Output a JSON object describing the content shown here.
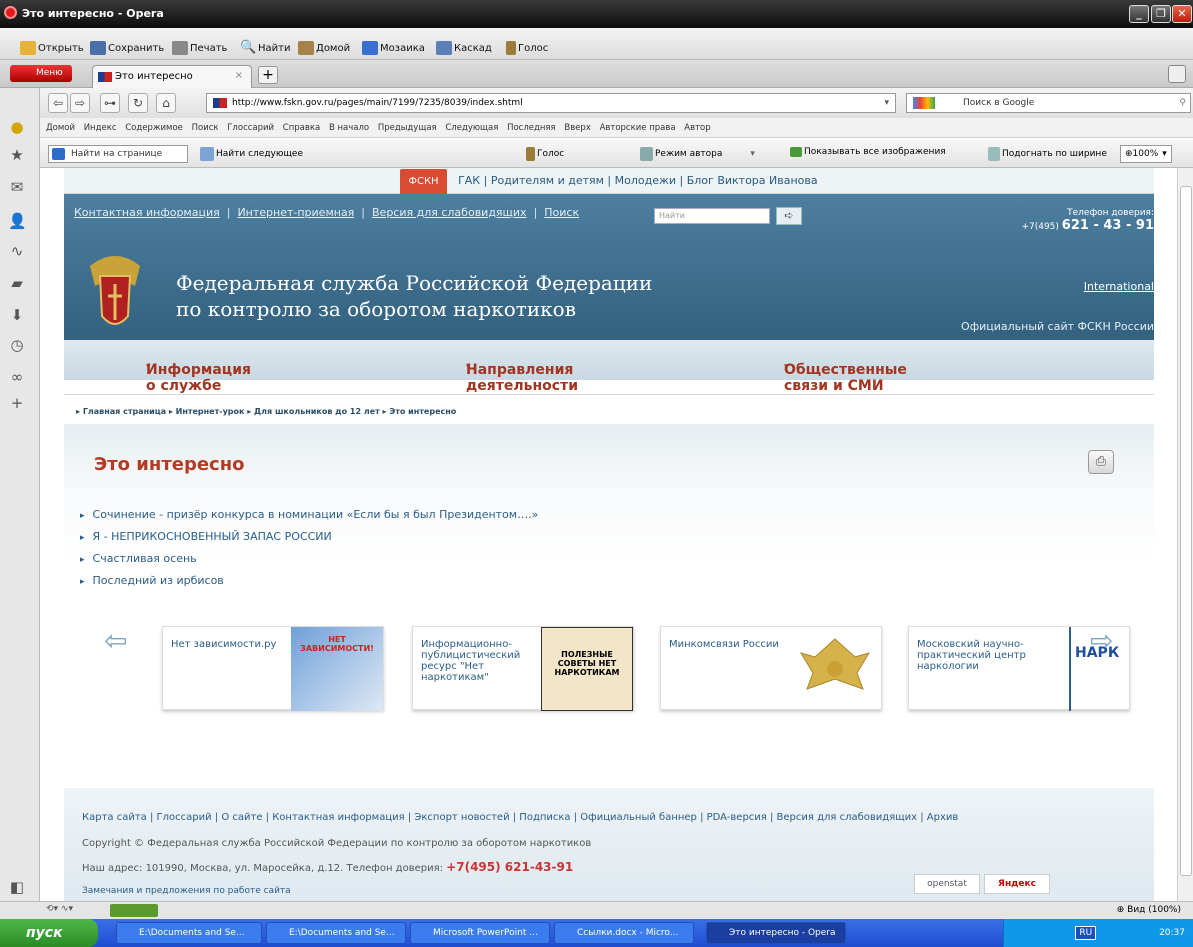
{
  "window": {
    "title": "Это интересно - Opera"
  },
  "toolbar": {
    "items": [
      "Открыть",
      "Сохранить",
      "Печать",
      "Найти",
      "Домой",
      "Мозаика",
      "Каскад",
      "Голос"
    ]
  },
  "tabs": {
    "menu": "Меню",
    "active": "Это интересно",
    "close": "×",
    "new": "+"
  },
  "address": {
    "url": "http://www.fskn.gov.ru/pages/main/7199/7235/8039/index.shtml",
    "search_placeholder": "Поиск в Google"
  },
  "bookmarks": [
    "Домой",
    "Индекс",
    "Содержимое",
    "Поиск",
    "Глоссарий",
    "Справка",
    "В начало",
    "Предыдущая",
    "Следующая",
    "Последняя",
    "Вверх",
    "Авторские права",
    "Автор"
  ],
  "findbar": {
    "placeholder": "Найти на странице",
    "next": "Найти следующее",
    "voice": "Голос",
    "author": "Режим автора",
    "images": "Показывать все изображения",
    "fit": "Подогнать по ширине",
    "zoom": "100%"
  },
  "page": {
    "topnav": {
      "active": "ФСКН",
      "items": [
        "ГАК",
        "Родителям и детям",
        "Молодежи",
        "Блог Виктора Иванова"
      ]
    },
    "header": {
      "links": [
        "Контактная информация",
        "Интернет-приемная",
        "Версия для слабовидящих",
        "Поиск"
      ],
      "search_placeholder": "Найти",
      "phone_label": "Телефон доверия:",
      "phone_prefix": "+7(495)",
      "phone_number": "621 - 43 - 91",
      "org_line1": "Федеральная служба Российской Федерации",
      "org_line2": "по контролю за оборотом наркотиков",
      "international": "International",
      "official": "Официальный сайт ФСКН России"
    },
    "mainnav": [
      "Информация о службе",
      "Направления деятельности",
      "Общественные связи и СМИ"
    ],
    "breadcrumb": [
      "Главная страница",
      "Интернет-урок",
      "Для школьников до 12 лет",
      "Это интересно"
    ],
    "title": "Это интересно",
    "articles": [
      "Сочинение - призёр конкурса в номинации «Если бы я был Президентом….»",
      "Я - НЕПРИКОСНОВЕННЫЙ ЗАПАС РОССИИ",
      "Счастливая осень",
      "Последний из ирбисов"
    ],
    "banners": [
      {
        "text": "Нет зависимости.ру",
        "img": "НЕТ ЗАВИСИМОСТИ!"
      },
      {
        "text": "Информационно-публицистический ресурс \"Нет наркотикам\"",
        "img": "ПОЛЕЗНЫЕ СОВЕТЫ НЕТ НАРКОТИКАМ"
      },
      {
        "text": "Минкомсвязи России",
        "img": ""
      },
      {
        "text": "Московский научно-практический центр наркологии",
        "img": "НАРК"
      }
    ],
    "footer": {
      "links": "Карта сайта | Глоссарий | О сайте | Контактная информация | Экспорт новостей | Подписка | Официальный баннер | PDA-версия | Версия для слабовидящих | Архив",
      "copyright": "Copyright © Федеральная служба Российской Федерации по контролю за оборотом наркотиков",
      "address": "Наш адрес: 101990, Москва, ул. Маросейка, д.12. Телефон доверия:",
      "phone": "+7(495) 621-43-91",
      "remarks": "Замечания и предложения по работе сайта",
      "openstat": "openstat",
      "yandex": "Яндекс"
    }
  },
  "status": {
    "zoom": "Вид (100%)"
  },
  "taskbar": {
    "start": "пуск",
    "tasks": [
      "E:\\Documents and Se...",
      "E:\\Documents and Se...",
      "Microsoft PowerPoint ...",
      "Ссылки.docx - Micro...",
      "Это интересно - Opera"
    ],
    "lang": "RU",
    "time": "20:37"
  }
}
